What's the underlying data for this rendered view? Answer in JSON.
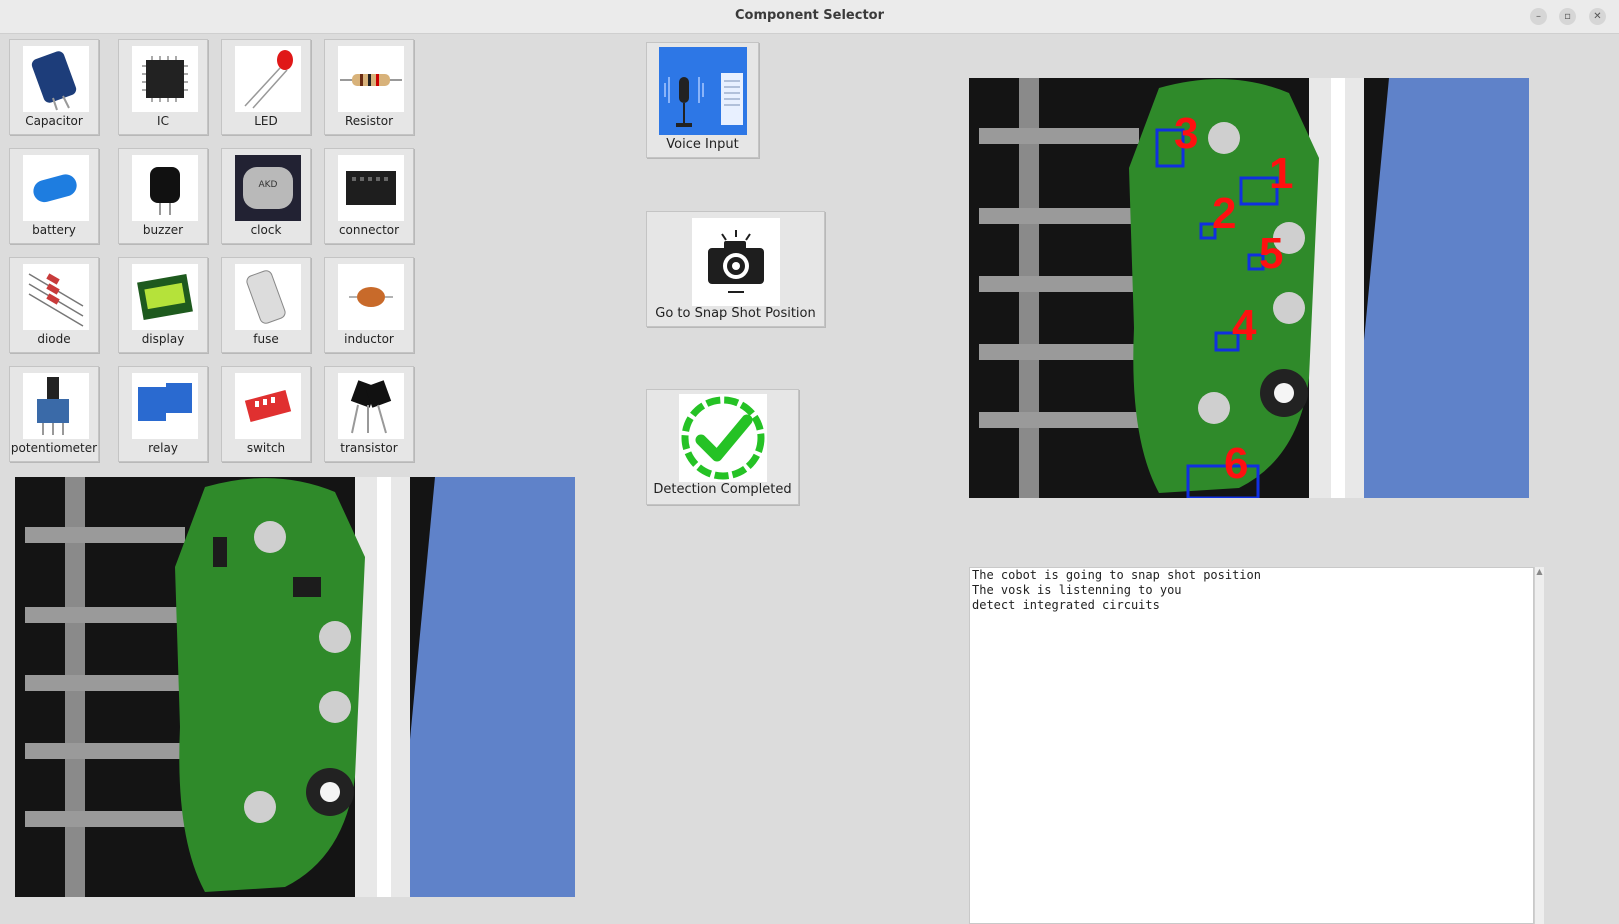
{
  "window": {
    "title": "Component Selector"
  },
  "components": [
    {
      "label": "Capacitor",
      "icon": "capacitor-icon"
    },
    {
      "label": "IC",
      "icon": "ic-chip-icon"
    },
    {
      "label": "LED",
      "icon": "led-icon"
    },
    {
      "label": "Resistor",
      "icon": "resistor-icon"
    },
    {
      "label": "battery",
      "icon": "battery-icon"
    },
    {
      "label": "buzzer",
      "icon": "buzzer-icon"
    },
    {
      "label": "clock",
      "icon": "clock-crystal-icon"
    },
    {
      "label": "connector",
      "icon": "connector-icon"
    },
    {
      "label": "diode",
      "icon": "diode-icon"
    },
    {
      "label": "display",
      "icon": "lcd-display-icon"
    },
    {
      "label": "fuse",
      "icon": "fuse-icon"
    },
    {
      "label": "inductor",
      "icon": "inductor-icon"
    },
    {
      "label": "potentiometer",
      "icon": "potentiometer-icon"
    },
    {
      "label": "relay",
      "icon": "relay-icon"
    },
    {
      "label": "switch",
      "icon": "dip-switch-icon"
    },
    {
      "label": "transistor",
      "icon": "transistor-icon"
    }
  ],
  "actions": {
    "voice": {
      "label": "Voice Input",
      "icon": "microphone-icon"
    },
    "snapshot": {
      "label": "Go to Snap Shot Position",
      "icon": "camera-icon"
    },
    "detection": {
      "label": "Detection Completed",
      "icon": "checkmark-icon"
    }
  },
  "detections": [
    "1",
    "2",
    "3",
    "4",
    "5",
    "6"
  ],
  "log": {
    "lines": [
      "The cobot is going to snap shot position",
      "The vosk is listenning to you",
      "detect integrated circuits"
    ]
  },
  "colors": {
    "detection_box": "#1030e0",
    "detection_label": "#ff1010",
    "pcb": "#2f8a2a",
    "check": "#25c225"
  }
}
